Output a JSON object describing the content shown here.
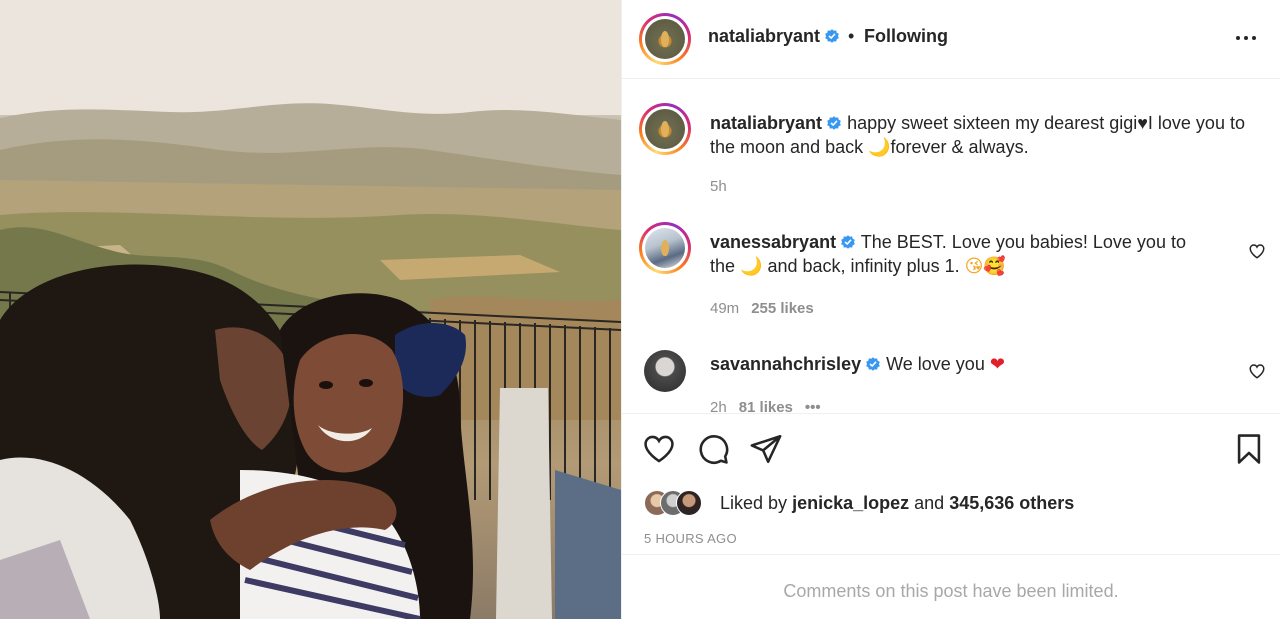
{
  "header": {
    "username": "nataliabryant",
    "separator": "•",
    "follow_status": "Following"
  },
  "caption": {
    "username": "nataliabryant",
    "text": "happy sweet sixteen my dearest gigi♥I love you to the moon and back 🌙forever & always.",
    "time": "5h"
  },
  "comments": [
    {
      "username": "vanessabryant",
      "text_1": "The BEST. Love you babies! Love you to the",
      "text_2": "and back, infinity plus 1.",
      "moon": "🌙",
      "emojis": "😘🥰",
      "time": "49m",
      "likes": "255 likes"
    },
    {
      "username": "savannahchrisley",
      "text": "We love you",
      "emoji": "❤",
      "time": "2h",
      "likes": "81 likes",
      "more": "•••"
    }
  ],
  "likes": {
    "prefix": "Liked by",
    "user": "jenicka_lopez",
    "middle": "and",
    "count": "345,636 others"
  },
  "posted_ago": "5 HOURS AGO",
  "limited_notice": "Comments on this post have been limited.",
  "colors": {
    "text": "#262626",
    "muted": "#8e8e8e",
    "verified": "#3897f0",
    "divider": "#efefef"
  },
  "icons": {
    "verified": "verified-badge-icon",
    "more": "more-options-icon",
    "like": "heart-icon",
    "comment": "comment-icon",
    "share": "share-icon",
    "save": "bookmark-icon"
  }
}
